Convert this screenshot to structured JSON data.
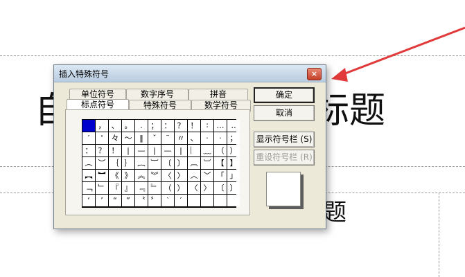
{
  "dialog": {
    "title": "插入特殊符号",
    "close_label": "×",
    "tabs_back": [
      "单位符号",
      "数字序号",
      "拼音"
    ],
    "tabs_front": [
      "标点符号",
      "特殊符号",
      "数学符号"
    ],
    "buttons": {
      "ok": "确定",
      "cancel": "取消",
      "show_bar": "显示符号栏 (S)",
      "reset_bar": "重设符号栏 (R)"
    },
    "symbols": [
      [
        "",
        "，",
        "、",
        "。",
        ".",
        "；",
        "：",
        "？",
        "！",
        "∶",
        "…",
        "‥"
      ],
      [
        "′",
        "'",
        "々",
        "～",
        "‖",
        "ˇ",
        "¨",
        "〃",
        "、",
        "·",
        "·",
        "；"
      ],
      [
        "：",
        "？",
        "！",
        "|",
        "—",
        "|",
        "—",
        "|",
        "︴",
        "﹏",
        "（",
        "）"
      ],
      [
        "︵",
        "︶",
        "｛",
        "｝",
        "︷",
        "︸",
        "〔",
        "〕",
        "︹",
        "︺",
        "【",
        "】"
      ],
      [
        "︻",
        "︼",
        "《",
        "》",
        "︽",
        "︾",
        "〈",
        "〉",
        "︿",
        "﹀",
        "「",
        "」"
      ],
      [
        "﹁",
        "﹂",
        "『",
        "』",
        "﹃",
        "﹄",
        "（",
        "）",
        "〈",
        "〉",
        "〔",
        "〕"
      ],
      [
        "‘",
        "’",
        "“",
        "”",
        "〝",
        "〞",
        "‵",
        "′",
        "",
        "",
        "",
        ""
      ]
    ]
  },
  "background": {
    "heading_left": "自",
    "heading_right": "标题",
    "subheading_right": "题"
  },
  "colors": {
    "dialog_face": "#ece9d8",
    "selected_cell": "#0000cc",
    "arrow": "#e03a3a"
  }
}
